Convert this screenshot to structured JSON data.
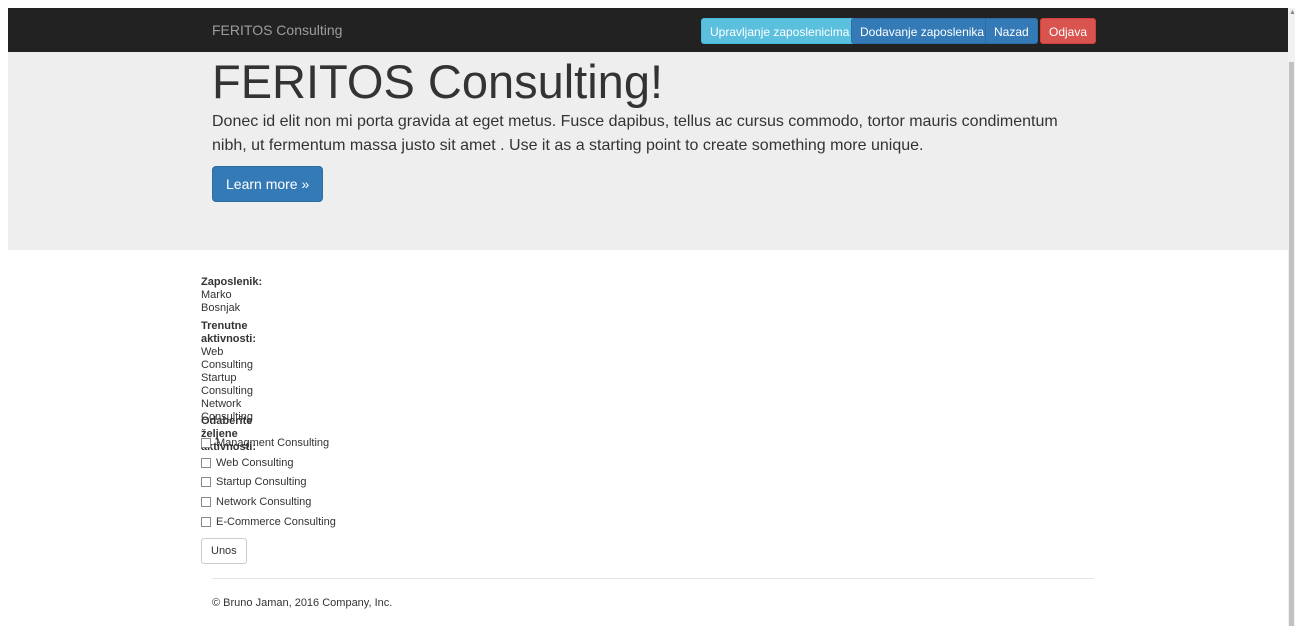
{
  "navbar": {
    "brand": "FERITOS Consulting",
    "buttons": {
      "manage_employees": "Upravljanje zaposlenicima",
      "add_employee": "Dodavanje zaposlenika",
      "back": "Nazad",
      "logout": "Odjava"
    }
  },
  "jumbotron": {
    "title": "FERITOS Consulting!",
    "text": "Donec id elit non mi porta gravida at eget metus. Fusce dapibus, tellus ac cursus commodo, tortor mauris condimentum nibh, ut fermentum massa justo sit amet . Use it as a starting point to create something more unique.",
    "learn_more": "Learn more »"
  },
  "employee": {
    "label": "Zaposlenik:",
    "name": "Marko Bosnjak"
  },
  "current_activities": {
    "label": "Trenutne aktivnosti:",
    "items": [
      "Web Consulting",
      "Startup Consulting",
      "Network Consulting"
    ]
  },
  "choose_activities": {
    "label": "Odaberite željene aktivnosti:",
    "options": [
      {
        "label": "Managment Consulting",
        "checked": false
      },
      {
        "label": "Web Consulting",
        "checked": false
      },
      {
        "label": "Startup Consulting",
        "checked": false
      },
      {
        "label": "Network Consulting",
        "checked": false
      },
      {
        "label": "E-Commerce Consulting",
        "checked": false
      }
    ],
    "submit": "Unos"
  },
  "footer": {
    "text": "© Bruno Jaman, 2016 Company, Inc."
  },
  "colors": {
    "navbar_bg": "#222222",
    "jumbotron_bg": "#eeeeee",
    "info": "#5bc0de",
    "primary": "#337ab7",
    "danger": "#d9534f"
  },
  "icons": [
    "scroll-up-arrow-icon"
  ]
}
